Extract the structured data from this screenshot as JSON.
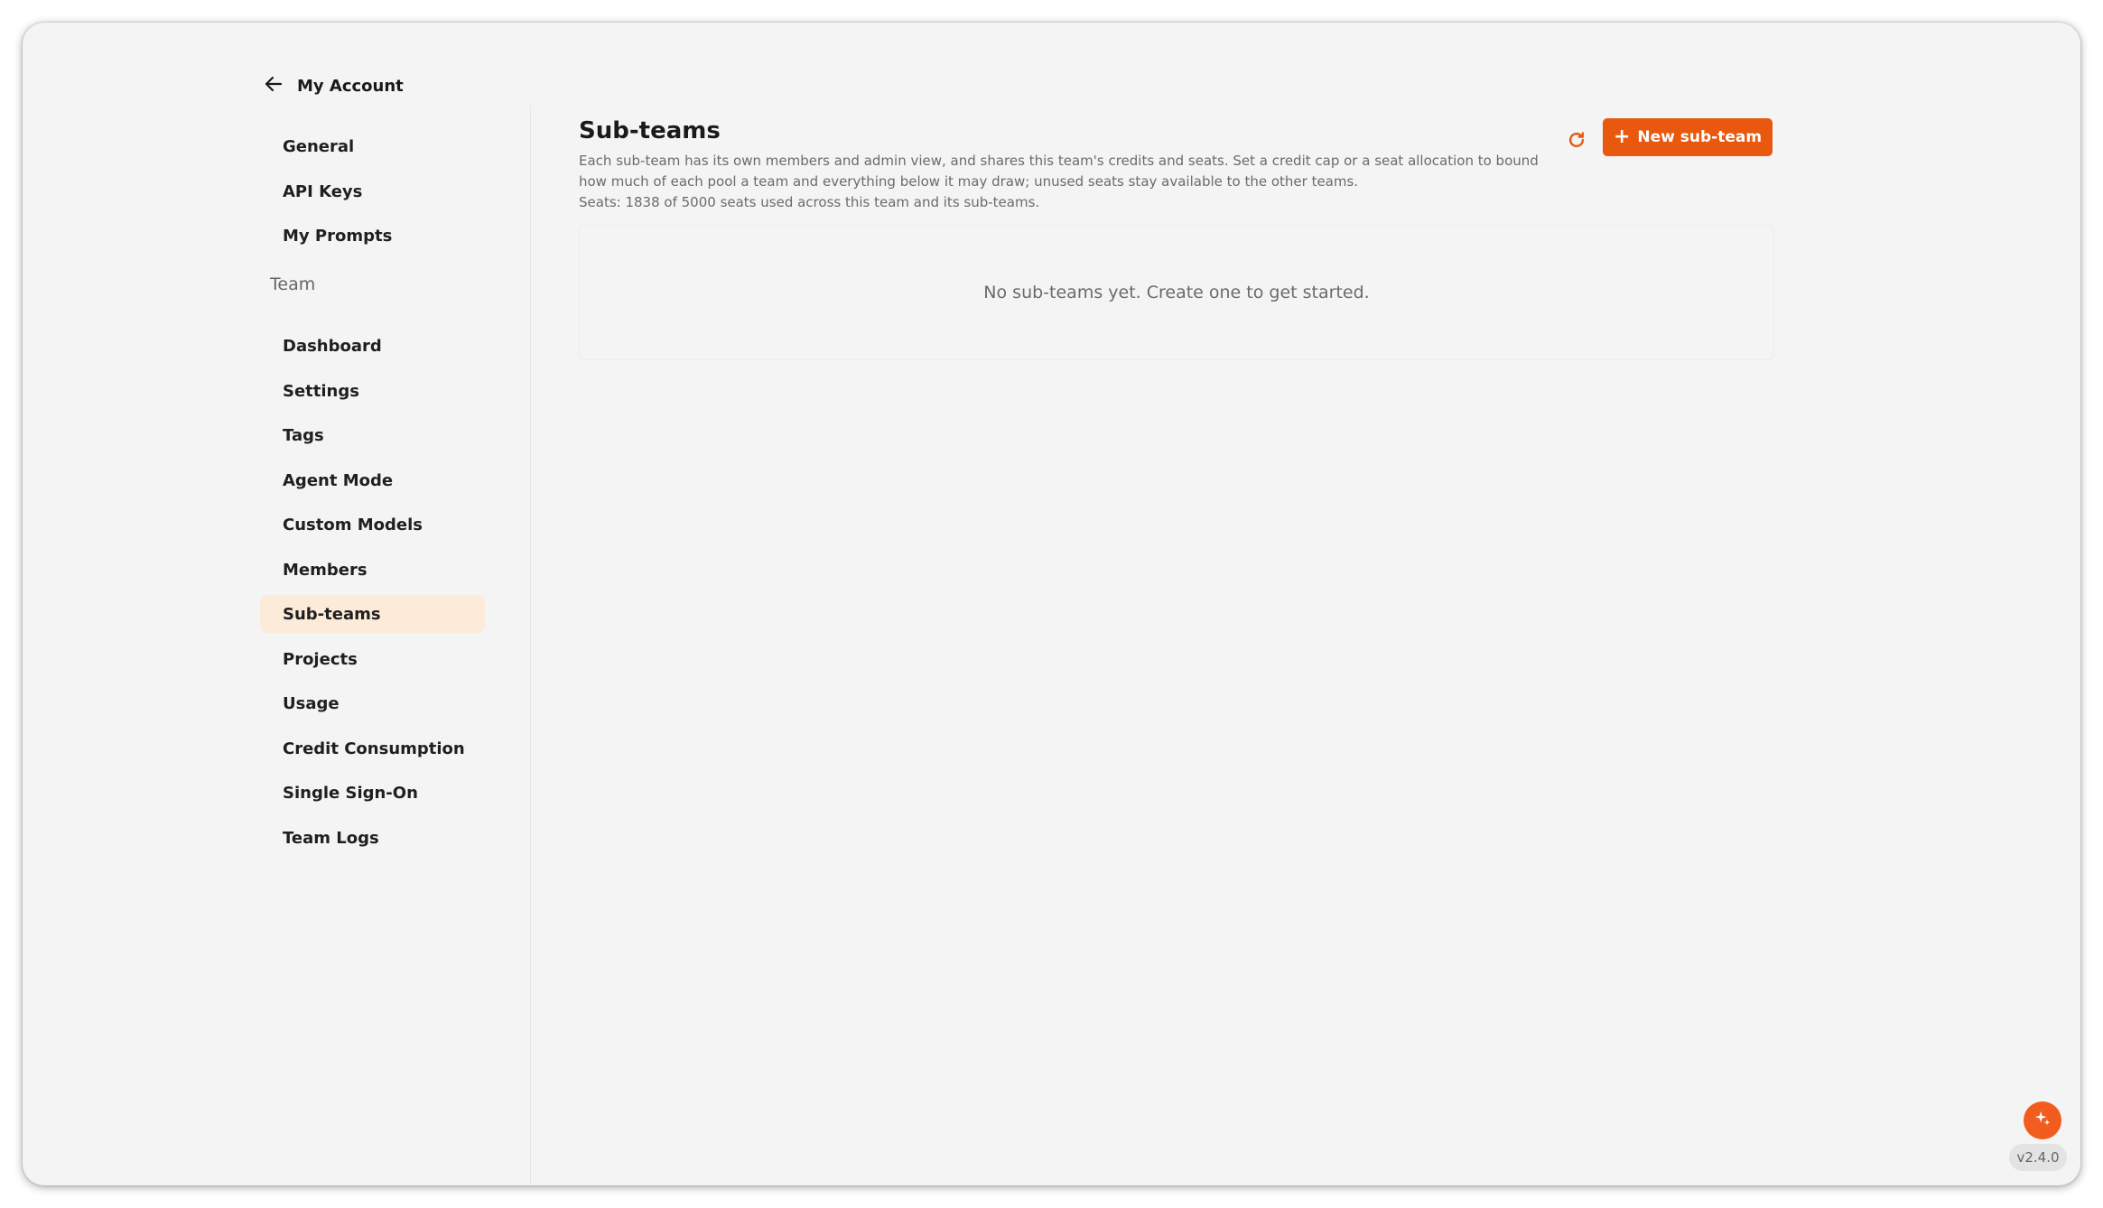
{
  "header": {
    "back_label": "My Account"
  },
  "sidebar": {
    "account_items": [
      {
        "label": "General"
      },
      {
        "label": "API Keys"
      },
      {
        "label": "My Prompts"
      }
    ],
    "team_section_label": "Team",
    "team_items": [
      {
        "label": "Dashboard"
      },
      {
        "label": "Settings"
      },
      {
        "label": "Tags"
      },
      {
        "label": "Agent Mode"
      },
      {
        "label": "Custom Models"
      },
      {
        "label": "Members"
      },
      {
        "label": "Sub-teams",
        "active": true
      },
      {
        "label": "Projects"
      },
      {
        "label": "Usage"
      },
      {
        "label": "Credit Consumption"
      },
      {
        "label": "Single Sign-On"
      },
      {
        "label": "Team Logs"
      }
    ]
  },
  "main": {
    "title": "Sub-teams",
    "description_line1": "Each sub-team has its own members and admin view, and shares this team's credits and seats. Set a credit cap or a seat allocation to bound",
    "description_line2": "how much of each pool a team and everything below it may draw; unused seats stay available to the other teams.",
    "seats_line": "Seats: 1838 of 5000 seats used across this team and its sub-teams.",
    "new_button_label": "New sub-team",
    "empty_message": "No sub-teams yet. Create one to get started."
  },
  "footer": {
    "version": "v2.4.0"
  },
  "colors": {
    "accent": "#e8590f",
    "active_nav_bg": "#fdebd9",
    "page_bg": "#f4f4f4"
  },
  "icons": {
    "back": "arrow-left-icon",
    "refresh": "refresh-icon",
    "add": "plus-icon",
    "assistant": "sparkle-icon"
  }
}
